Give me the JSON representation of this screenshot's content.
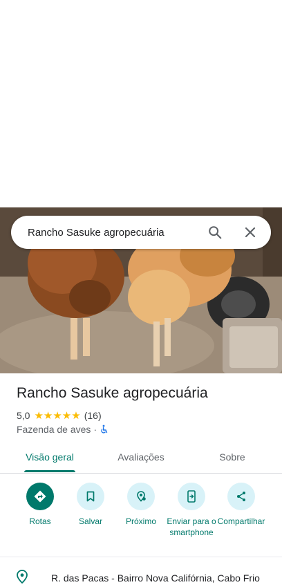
{
  "search": {
    "query": "Rancho Sasuke agropecuária"
  },
  "place": {
    "name": "Rancho Sasuke agropecuária",
    "rating": "5,0",
    "stars": "★★★★★",
    "review_count": "(16)",
    "category": "Fazenda de aves",
    "separator": "·"
  },
  "tabs": [
    {
      "label": "Visão geral",
      "active": true
    },
    {
      "label": "Avaliações",
      "active": false
    },
    {
      "label": "Sobre",
      "active": false
    }
  ],
  "actions": [
    {
      "label": "Rotas",
      "icon": "directions-icon"
    },
    {
      "label": "Salvar",
      "icon": "bookmark-icon"
    },
    {
      "label": "Próximo",
      "icon": "nearby-icon"
    },
    {
      "label": "Enviar para o smartphone",
      "icon": "send-to-phone-icon"
    },
    {
      "label": "Compartilhar",
      "icon": "share-icon"
    }
  ],
  "address": {
    "text": "R. das Pacas - Bairro Nova Califórnia, Cabo Frio",
    "icon": "location-pin-icon"
  },
  "colors": {
    "accent": "#00796b",
    "action_bg": "#d8f2f8",
    "star": "#fbbc04"
  }
}
